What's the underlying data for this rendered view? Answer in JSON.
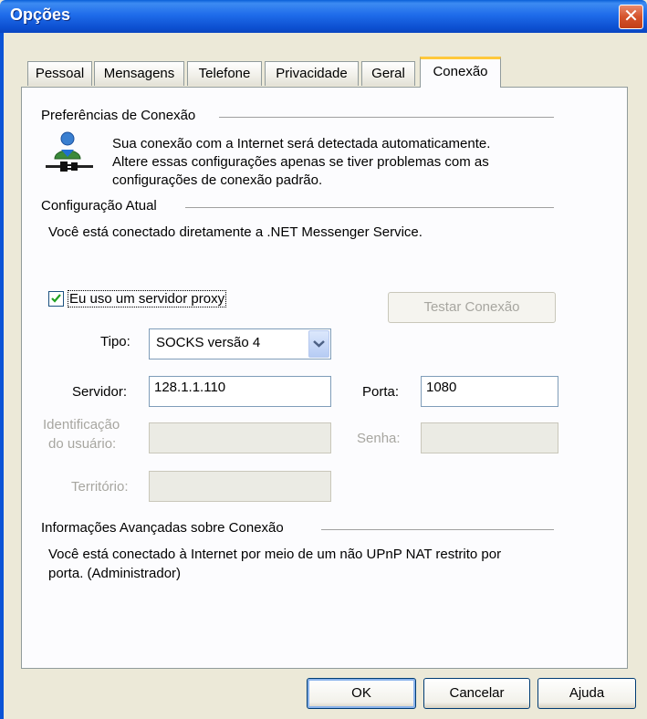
{
  "window": {
    "title": "Opções",
    "close_glyph": "✕"
  },
  "tabs": [
    {
      "label": "Pessoal",
      "active": false
    },
    {
      "label": "Mensagens",
      "active": false
    },
    {
      "label": "Telefone",
      "active": false
    },
    {
      "label": "Privacidade",
      "active": false
    },
    {
      "label": "Geral",
      "active": false
    },
    {
      "label": "Conexão",
      "active": true
    }
  ],
  "connection_prefs": {
    "title": "Preferências de Conexão",
    "line1": "Sua conexão com a Internet será detectada automaticamente.",
    "line2": "Altere essas configurações apenas se tiver problemas com as",
    "line3": "configurações de conexão padrão.",
    "icon": "network-user-icon"
  },
  "current_config": {
    "title": "Configuração Atual",
    "text": "Você está conectado diretamente a .NET Messenger Service."
  },
  "proxy": {
    "checkbox_label": "Eu uso um servidor proxy",
    "checked": true,
    "test_button": "Testar Conexão",
    "type_label": "Tipo:",
    "type_value": "SOCKS versão 4",
    "server_label": "Servidor:",
    "server_value": "128.1.1.110",
    "port_label": "Porta:",
    "port_value": "1080",
    "user_label_1": "Identificação",
    "user_label_2": "do usuário:",
    "user_value": "",
    "password_label": "Senha:",
    "password_value": "",
    "domain_label": "Território:",
    "domain_value": ""
  },
  "advanced": {
    "title": "Informações Avançadas sobre Conexão",
    "line1": "Você está conectado à Internet por meio de um não UPnP NAT restrito por",
    "line2": "porta. (Administrador)"
  },
  "buttons": {
    "ok": "OK",
    "cancel": "Cancelar",
    "help": "Ajuda"
  },
  "colors": {
    "titlebar": "#0a5fd8",
    "dialog": "#ece9d8",
    "panel": "#fcfcfe",
    "active_tab_accent": "#ffc83c"
  }
}
